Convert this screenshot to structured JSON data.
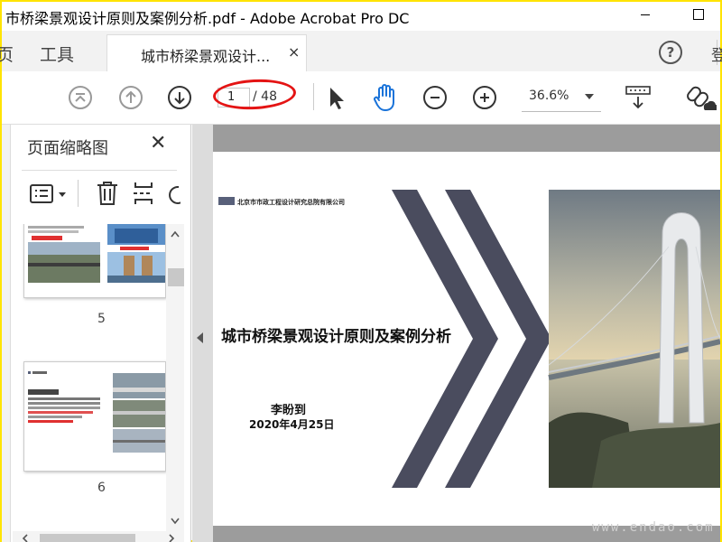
{
  "window": {
    "title": "市桥梁景观设计原则及案例分析.pdf - Adobe Acrobat Pro DC"
  },
  "tabs": {
    "home_partial": "页",
    "tools": "工具",
    "document": "城市桥梁景观设计...",
    "close_glyph": "×",
    "help_glyph": "?",
    "signin_partial": "登"
  },
  "toolbar": {
    "current_page": "1",
    "total_pages": "/ 48",
    "zoom": "36.6%"
  },
  "panel": {
    "title": "页面缩略图",
    "close_glyph": "✕",
    "thumbnails": [
      {
        "number": "5"
      },
      {
        "number": "6"
      }
    ]
  },
  "slide": {
    "org_name": "北京市市政工程设计研究总院有限公司",
    "title": "城市桥梁景观设计原则及案例分析",
    "author": "李盼到",
    "date": "2020年4月25日"
  },
  "watermark": "www.endao.com",
  "colors": {
    "accent_red": "#e41414",
    "chevron": "#4a4c5e",
    "hand_tool": "#1a73d9",
    "gray_bar": "#9c9c9c"
  }
}
